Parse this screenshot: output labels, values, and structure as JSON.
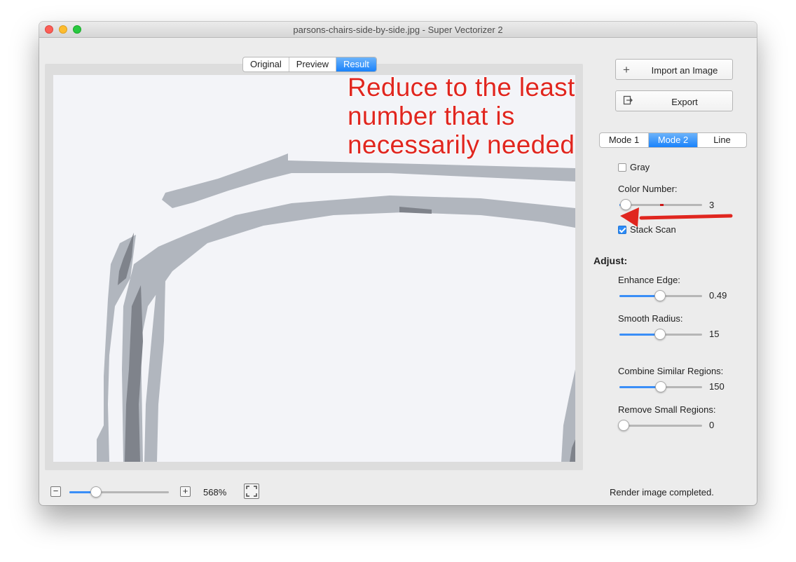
{
  "window": {
    "title": "parsons-chairs-side-by-side.jpg - Super Vectorizer 2"
  },
  "view_tabs": [
    {
      "label": "Original",
      "active": false
    },
    {
      "label": "Preview",
      "active": false
    },
    {
      "label": "Result",
      "active": true
    }
  ],
  "annotation": {
    "lines": [
      "Reduce to the least",
      "number that is",
      "necessarily needed"
    ],
    "color": "#e0261f"
  },
  "actions": {
    "import_label": "Import an Image",
    "import_icon": "plus-icon",
    "export_label": "Export",
    "export_icon": "export-icon"
  },
  "modes": [
    {
      "label": "Mode 1",
      "active": false
    },
    {
      "label": "Mode 2",
      "active": true
    },
    {
      "label": "Line",
      "active": false
    }
  ],
  "options": {
    "gray_label": "Gray",
    "gray_checked": false,
    "color_number_label": "Color Number:",
    "color_number_value": "3",
    "color_number_fraction": 0.03,
    "stack_scan_label": "Stack Scan",
    "stack_scan_checked": true
  },
  "adjust": {
    "heading": "Adjust:",
    "enhance_edge_label": "Enhance Edge:",
    "enhance_edge_value": "0.49",
    "enhance_edge_fraction": 0.49,
    "smooth_radius_label": "Smooth Radius:",
    "smooth_radius_value": "15",
    "smooth_radius_fraction": 0.49,
    "combine_label": "Combine Similar Regions:",
    "combine_value": "150",
    "combine_fraction": 0.5,
    "remove_label": "Remove Small Regions:",
    "remove_value": "0",
    "remove_fraction": 0.0
  },
  "bottom": {
    "zoom_value": "568%",
    "zoom_fraction": 0.27,
    "status": "Render image completed."
  },
  "colors": {
    "accent": "#1a82fb",
    "annotation_red": "#e0261f",
    "canvas_bg": "#f3f4f8",
    "shape_light": "#b1b6be",
    "shape_dark": "#7f838b"
  }
}
